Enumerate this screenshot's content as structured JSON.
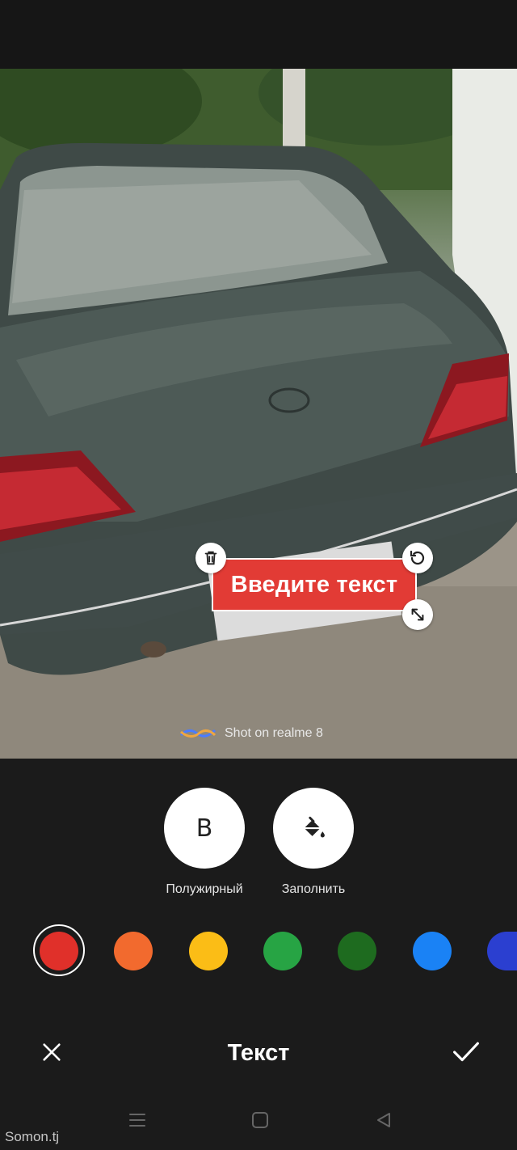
{
  "photo": {
    "watermark_text": "Shot on realme 8"
  },
  "sticker": {
    "text": "Введите текст",
    "fill_color": "#e23b35",
    "text_color": "#ffffff"
  },
  "tools": {
    "bold_letter": "B",
    "bold_label": "Полужирный",
    "fill_label": "Заполнить"
  },
  "palette": {
    "selected_index": 0,
    "colors": [
      "#e0302a",
      "#f26a2e",
      "#fbbd16",
      "#27a444",
      "#1e6b1f",
      "#1a82f5",
      "#2b3fd0"
    ]
  },
  "action_bar": {
    "title": "Текст",
    "close_icon": "close-icon",
    "confirm_icon": "check-icon"
  },
  "nav": {
    "menu_icon": "menu-icon",
    "home_icon": "home-icon",
    "back_icon": "back-icon"
  },
  "site_watermark": "Somon.tj"
}
